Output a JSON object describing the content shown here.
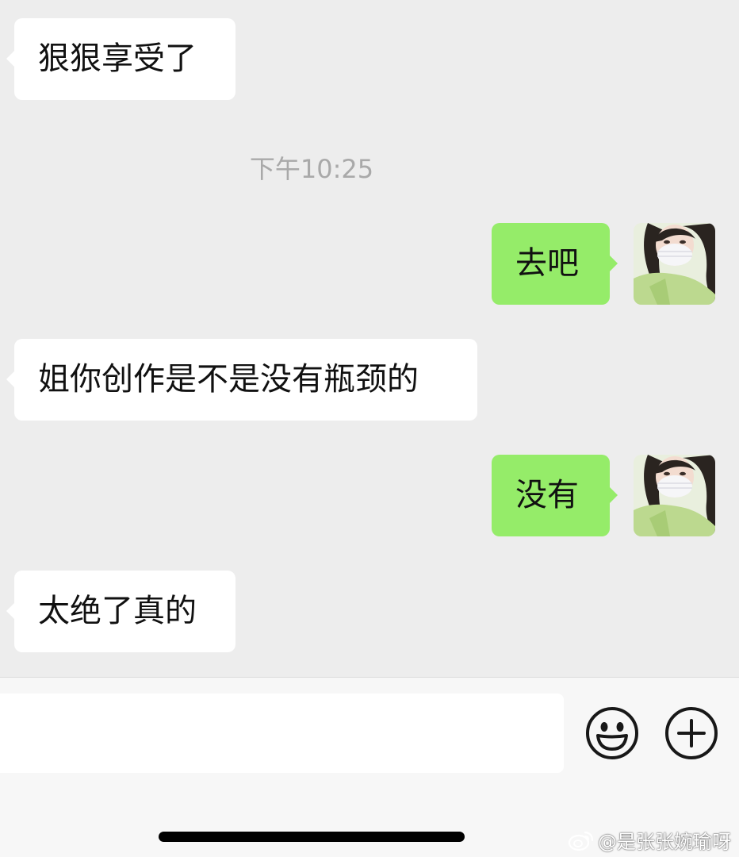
{
  "messages": [
    {
      "side": "in",
      "text": "狠狠享受了"
    },
    {
      "side": "out",
      "text": "去吧"
    },
    {
      "side": "in",
      "text": "姐你创作是不是没有瓶颈的"
    },
    {
      "side": "out",
      "text": "没有"
    },
    {
      "side": "in",
      "text": "太绝了真的"
    }
  ],
  "timestamp": "下午10:25",
  "input": {
    "value": "",
    "placeholder": ""
  },
  "icons": {
    "emoji": "emoji-face-icon",
    "plus": "plus-circle-icon",
    "weibo": "weibo-logo-icon"
  },
  "watermark": "@是张张婉瑜呀",
  "colors": {
    "background": "#ededed",
    "outgoing_bubble": "#95ec69",
    "incoming_bubble": "#ffffff",
    "timestamp_text": "#a9a9a9"
  }
}
